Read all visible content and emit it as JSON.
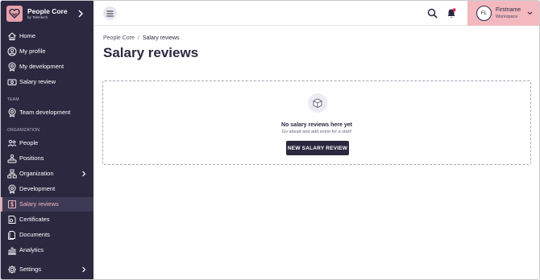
{
  "brand": {
    "name": "People Core",
    "subtitle": "by Talentech",
    "logo_color": "#e8a1ab"
  },
  "sidebar": {
    "items": [
      {
        "label": "Home",
        "icon": "home-icon"
      },
      {
        "label": "My profile",
        "icon": "user-circle-icon"
      },
      {
        "label": "My development",
        "icon": "development-icon"
      },
      {
        "label": "Salary review",
        "icon": "money-icon"
      },
      {
        "label": "Team development",
        "icon": "development-icon"
      },
      {
        "label": "People",
        "icon": "people-icon"
      },
      {
        "label": "Positions",
        "icon": "positions-icon"
      },
      {
        "label": "Organization",
        "icon": "organization-icon"
      },
      {
        "label": "Development",
        "icon": "development-icon"
      },
      {
        "label": "Salary reviews",
        "icon": "dollar-icon",
        "active": true
      },
      {
        "label": "Certificates",
        "icon": "certificate-icon"
      },
      {
        "label": "Documents",
        "icon": "documents-icon"
      },
      {
        "label": "Analytics",
        "icon": "analytics-icon"
      },
      {
        "label": "Settings",
        "icon": "gear-icon"
      }
    ],
    "sections": {
      "team": "TEAM",
      "organization": "ORGANIZATION"
    }
  },
  "topbar": {
    "menu_icon": "hamburger-icon",
    "search_icon": "search-icon",
    "bell_icon": "bell-icon",
    "notification_color": "#e0245e"
  },
  "user": {
    "initials": "FL",
    "name": "Firstname",
    "workspace": "Workspace",
    "accent": "#f3b9bf"
  },
  "main": {
    "breadcrumb": {
      "root": "People Core",
      "separator": "/",
      "current": "Salary reviews"
    },
    "title": "Salary reviews",
    "empty_state": {
      "icon": "box-icon",
      "title": "No salary reviews here yet",
      "subtitle": "Go ahead and add some for a start!",
      "button": "NEW SALARY REVIEW"
    }
  },
  "colors": {
    "sidebar_bg": "#2b2840",
    "active_accent": "#e8a1ab"
  }
}
